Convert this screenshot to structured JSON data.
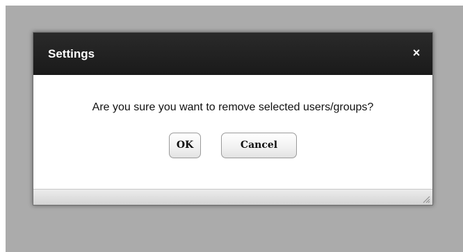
{
  "dialog": {
    "title": "Settings",
    "close_glyph": "×",
    "message": "Are you sure you want to remove selected users/groups?",
    "ok_label": "OK",
    "cancel_label": "Cancel",
    "resize_icon": "resize-grip-icon"
  },
  "colors": {
    "titlebar": "#1f1f1f",
    "overlay": "#ababab",
    "footer": "#dedede"
  }
}
